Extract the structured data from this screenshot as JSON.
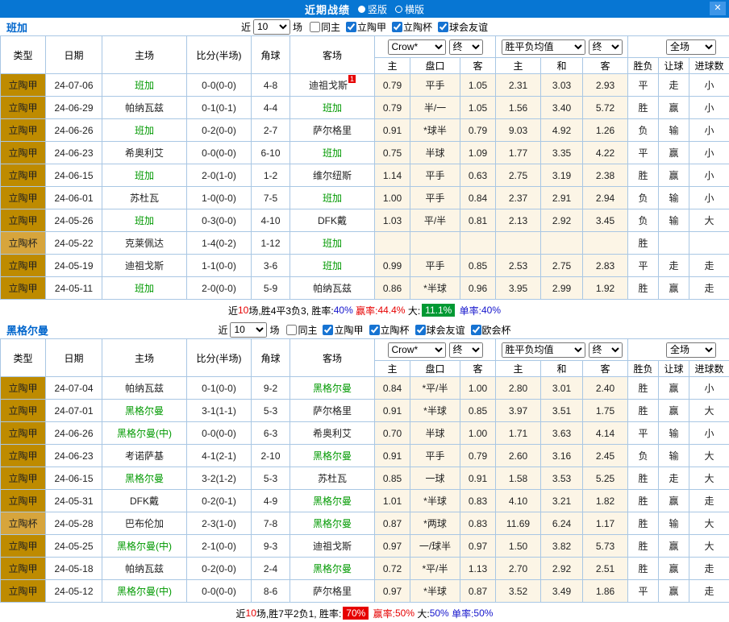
{
  "titlebar": {
    "title": "近期战绩",
    "vertical_label": "竖版",
    "horizontal_label": "横版",
    "close_label": "✕"
  },
  "filter_labels": {
    "near": "近",
    "games": "场"
  },
  "table_header": {
    "type": "类型",
    "date": "日期",
    "home": "主场",
    "score": "比分(半场)",
    "corners": "角球",
    "away": "客场",
    "odds_source": "Crow*",
    "europe_source": "胜平负均值",
    "final_label": "终",
    "scope": "全场",
    "odds_sub": [
      "主",
      "盘口",
      "客"
    ],
    "europe_sub": [
      "主",
      "和",
      "客"
    ],
    "result_sub": [
      "胜负",
      "让球",
      "进球数"
    ]
  },
  "colors": {
    "titlebar_blue": "#0776D3",
    "league_type_bg": "#BE8B00",
    "cup_type_bg": "#D7A53C",
    "win_red": "#E60000",
    "lose_green": "#009900",
    "push_blue": "#1414CC",
    "team_focus_green": "#009900",
    "odds_bg": "#FCF5E6"
  },
  "sections": [
    {
      "team": "班加",
      "filter": {
        "count": "10",
        "checkboxes": [
          {
            "label": "同主",
            "checked": false
          },
          {
            "label": "立陶甲",
            "checked": true
          },
          {
            "label": "立陶杯",
            "checked": true
          },
          {
            "label": "球会友谊",
            "checked": true
          }
        ]
      },
      "rows": [
        {
          "type": "立陶甲",
          "date": "24-07-06",
          "home": "班加",
          "home_focus": true,
          "away": "迪祖戈斯",
          "away_badge": "1",
          "score": "0-0(0-0)",
          "corner": "4-8",
          "crown": [
            "0.79",
            "平手",
            "1.05"
          ],
          "europe": [
            "2.31",
            "3.03",
            "2.93"
          ],
          "outcome": "平",
          "handicap": "走",
          "goals": "小"
        },
        {
          "type": "立陶甲",
          "date": "24-06-29",
          "home": "帕纳瓦兹",
          "away": "班加",
          "away_focus": true,
          "score": "0-1(0-1)",
          "corner": "4-4",
          "crown": [
            "0.79",
            "半/一",
            "1.05"
          ],
          "europe": [
            "1.56",
            "3.40",
            "5.72"
          ],
          "outcome": "胜",
          "handicap": "赢",
          "goals": "小"
        },
        {
          "type": "立陶甲",
          "date": "24-06-26",
          "home": "班加",
          "home_focus": true,
          "away": "萨尔格里",
          "score": "0-2(0-0)",
          "corner": "2-7",
          "crown": [
            "0.91",
            "*球半",
            "0.79"
          ],
          "europe": [
            "9.03",
            "4.92",
            "1.26"
          ],
          "outcome": "负",
          "handicap": "输",
          "goals": "小"
        },
        {
          "type": "立陶甲",
          "date": "24-06-23",
          "home": "希奥利艾",
          "away": "班加",
          "away_focus": true,
          "score": "0-0(0-0)",
          "corner": "6-10",
          "crown": [
            "0.75",
            "半球",
            "1.09"
          ],
          "europe": [
            "1.77",
            "3.35",
            "4.22"
          ],
          "outcome": "平",
          "handicap": "赢",
          "goals": "小"
        },
        {
          "type": "立陶甲",
          "date": "24-06-15",
          "home": "班加",
          "home_focus": true,
          "away": "维尔纽斯",
          "score": "2-0(1-0)",
          "corner": "1-2",
          "crown": [
            "1.14",
            "平手",
            "0.63"
          ],
          "europe": [
            "2.75",
            "3.19",
            "2.38"
          ],
          "outcome": "胜",
          "handicap": "赢",
          "goals": "小"
        },
        {
          "type": "立陶甲",
          "date": "24-06-01",
          "home": "苏杜瓦",
          "away": "班加",
          "away_focus": true,
          "score": "1-0(0-0)",
          "corner": "7-5",
          "crown": [
            "1.00",
            "平手",
            "0.84"
          ],
          "europe": [
            "2.37",
            "2.91",
            "2.94"
          ],
          "outcome": "负",
          "handicap": "输",
          "goals": "小"
        },
        {
          "type": "立陶甲",
          "date": "24-05-26",
          "home": "班加",
          "home_focus": true,
          "away": "DFK戴",
          "score": "0-3(0-0)",
          "corner": "4-10",
          "crown": [
            "1.03",
            "平/半",
            "0.81"
          ],
          "europe": [
            "2.13",
            "2.92",
            "3.45"
          ],
          "outcome": "负",
          "handicap": "输",
          "goals": "大"
        },
        {
          "type": "立陶杯",
          "date": "24-05-22",
          "home": "克莱佩达",
          "away": "班加",
          "away_focus": true,
          "score": "1-4(0-2)",
          "corner": "1-12",
          "crown": [
            "",
            "",
            ""
          ],
          "europe": [
            "",
            "",
            ""
          ],
          "outcome": "胜",
          "handicap": "",
          "goals": ""
        },
        {
          "type": "立陶甲",
          "date": "24-05-19",
          "home": "迪祖戈斯",
          "away": "班加",
          "away_focus": true,
          "score": "1-1(0-0)",
          "corner": "3-6",
          "crown": [
            "0.99",
            "平手",
            "0.85"
          ],
          "europe": [
            "2.53",
            "2.75",
            "2.83"
          ],
          "outcome": "平",
          "handicap": "走",
          "goals": "走"
        },
        {
          "type": "立陶甲",
          "date": "24-05-11",
          "home": "班加",
          "home_focus": true,
          "away": "帕纳瓦兹",
          "score": "2-0(0-0)",
          "corner": "5-9",
          "crown": [
            "0.86",
            "*半球",
            "0.96"
          ],
          "europe": [
            "3.95",
            "2.99",
            "1.92"
          ],
          "outcome": "胜",
          "handicap": "赢",
          "goals": "走"
        }
      ],
      "summary": [
        {
          "t": "近",
          "c": "k"
        },
        {
          "t": "10",
          "c": "red"
        },
        {
          "t": "场,胜4平3负3, ",
          "c": "k"
        },
        {
          "t": "胜率:",
          "c": "k"
        },
        {
          "t": "40%",
          "c": "blue"
        },
        {
          "t": " ",
          "c": "k"
        },
        {
          "t": "赢率:",
          "c": "red"
        },
        {
          "t": "44.4%",
          "c": "red"
        },
        {
          "t": " 大:",
          "c": "k"
        },
        {
          "t": "11.1%",
          "c": "gbox"
        },
        {
          "t": " ",
          "c": "k"
        },
        {
          "t": "单率:",
          "c": "blue"
        },
        {
          "t": "40%",
          "c": "blue"
        }
      ]
    },
    {
      "team": "黑格尔曼",
      "filter": {
        "count": "10",
        "checkboxes": [
          {
            "label": "同主",
            "checked": false
          },
          {
            "label": "立陶甲",
            "checked": true
          },
          {
            "label": "立陶杯",
            "checked": true
          },
          {
            "label": "球会友谊",
            "checked": true
          },
          {
            "label": "欧会杯",
            "checked": true
          }
        ]
      },
      "rows": [
        {
          "type": "立陶甲",
          "date": "24-07-04",
          "home": "帕纳瓦兹",
          "away": "黑格尔曼",
          "away_focus": true,
          "score": "0-1(0-0)",
          "corner": "9-2",
          "crown": [
            "0.84",
            "*平/半",
            "1.00"
          ],
          "europe": [
            "2.80",
            "3.01",
            "2.40"
          ],
          "outcome": "胜",
          "handicap": "赢",
          "goals": "小"
        },
        {
          "type": "立陶甲",
          "date": "24-07-01",
          "home": "黑格尔曼",
          "home_focus": true,
          "away": "萨尔格里",
          "score": "3-1(1-1)",
          "corner": "5-3",
          "crown": [
            "0.91",
            "*半球",
            "0.85"
          ],
          "europe": [
            "3.97",
            "3.51",
            "1.75"
          ],
          "outcome": "胜",
          "handicap": "赢",
          "goals": "大"
        },
        {
          "type": "立陶甲",
          "date": "24-06-26",
          "home": "黑格尔曼(中)",
          "home_focus": true,
          "away": "希奥利艾",
          "score": "0-0(0-0)",
          "corner": "6-3",
          "crown": [
            "0.70",
            "半球",
            "1.00"
          ],
          "europe": [
            "1.71",
            "3.63",
            "4.14"
          ],
          "outcome": "平",
          "handicap": "输",
          "goals": "小"
        },
        {
          "type": "立陶甲",
          "date": "24-06-23",
          "home": "考诺萨基",
          "away": "黑格尔曼",
          "away_focus": true,
          "score": "4-1(2-1)",
          "corner": "2-10",
          "crown": [
            "0.91",
            "平手",
            "0.79"
          ],
          "europe": [
            "2.60",
            "3.16",
            "2.45"
          ],
          "outcome": "负",
          "handicap": "输",
          "goals": "大"
        },
        {
          "type": "立陶甲",
          "date": "24-06-15",
          "home": "黑格尔曼",
          "home_focus": true,
          "away": "苏杜瓦",
          "score": "3-2(1-2)",
          "corner": "5-3",
          "crown": [
            "0.85",
            "一球",
            "0.91"
          ],
          "europe": [
            "1.58",
            "3.53",
            "5.25"
          ],
          "outcome": "胜",
          "handicap": "走",
          "goals": "大"
        },
        {
          "type": "立陶甲",
          "date": "24-05-31",
          "home": "DFK戴",
          "away": "黑格尔曼",
          "away_focus": true,
          "score": "0-2(0-1)",
          "corner": "4-9",
          "crown": [
            "1.01",
            "*半球",
            "0.83"
          ],
          "europe": [
            "4.10",
            "3.21",
            "1.82"
          ],
          "outcome": "胜",
          "handicap": "赢",
          "goals": "走"
        },
        {
          "type": "立陶杯",
          "date": "24-05-28",
          "home": "巴布伦加",
          "away": "黑格尔曼",
          "away_focus": true,
          "score": "2-3(1-0)",
          "corner": "7-8",
          "crown": [
            "0.87",
            "*两球",
            "0.83"
          ],
          "europe": [
            "11.69",
            "6.24",
            "1.17"
          ],
          "outcome": "胜",
          "handicap": "输",
          "goals": "大"
        },
        {
          "type": "立陶甲",
          "date": "24-05-25",
          "home": "黑格尔曼(中)",
          "home_focus": true,
          "away": "迪祖戈斯",
          "score": "2-1(0-0)",
          "corner": "9-3",
          "crown": [
            "0.97",
            "一/球半",
            "0.97"
          ],
          "europe": [
            "1.50",
            "3.82",
            "5.73"
          ],
          "outcome": "胜",
          "handicap": "赢",
          "goals": "大"
        },
        {
          "type": "立陶甲",
          "date": "24-05-18",
          "home": "帕纳瓦兹",
          "away": "黑格尔曼",
          "away_focus": true,
          "score": "0-2(0-0)",
          "corner": "2-4",
          "crown": [
            "0.72",
            "*平/半",
            "1.13"
          ],
          "europe": [
            "2.70",
            "2.92",
            "2.51"
          ],
          "outcome": "胜",
          "handicap": "赢",
          "goals": "走"
        },
        {
          "type": "立陶甲",
          "date": "24-05-12",
          "home": "黑格尔曼(中)",
          "home_focus": true,
          "away": "萨尔格里",
          "score": "0-0(0-0)",
          "corner": "8-6",
          "crown": [
            "0.97",
            "*半球",
            "0.87"
          ],
          "europe": [
            "3.52",
            "3.49",
            "1.86"
          ],
          "outcome": "平",
          "handicap": "赢",
          "goals": "走"
        }
      ],
      "summary": [
        {
          "t": "近",
          "c": "k"
        },
        {
          "t": "10",
          "c": "red"
        },
        {
          "t": "场,胜7平2负1, ",
          "c": "k"
        },
        {
          "t": "胜率:",
          "c": "k"
        },
        {
          "t": "70%",
          "c": "rbox"
        },
        {
          "t": " ",
          "c": "k"
        },
        {
          "t": "赢率:",
          "c": "red"
        },
        {
          "t": "50%",
          "c": "red"
        },
        {
          "t": " 大:",
          "c": "k"
        },
        {
          "t": "50%",
          "c": "blue"
        },
        {
          "t": " ",
          "c": "k"
        },
        {
          "t": "单率:",
          "c": "blue"
        },
        {
          "t": "50%",
          "c": "blue"
        }
      ]
    }
  ]
}
